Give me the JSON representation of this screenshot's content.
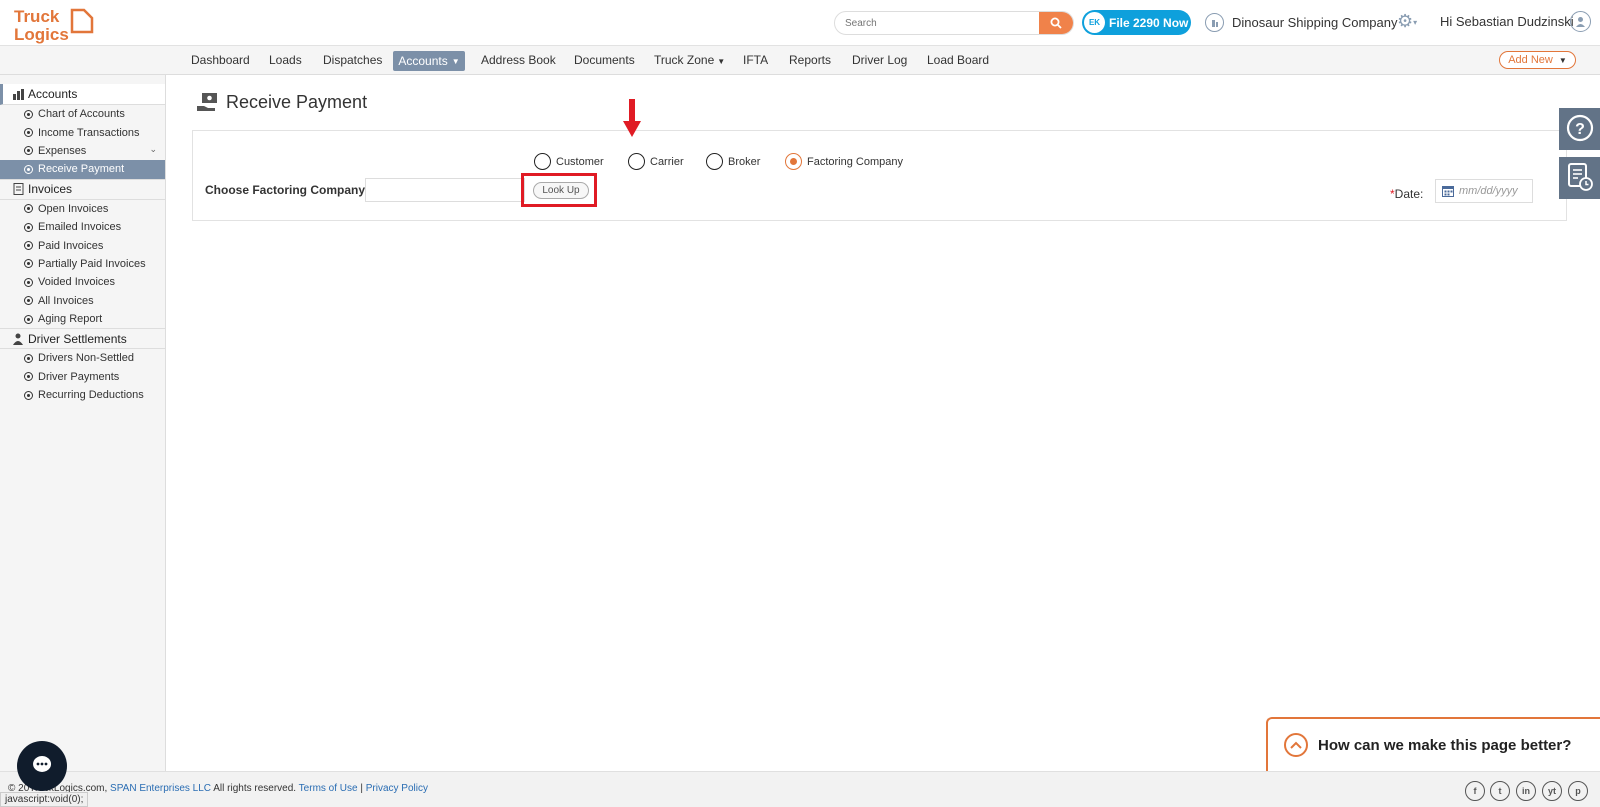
{
  "header": {
    "logo_text_top": "Truck",
    "logo_text_bottom": "Logics",
    "search_placeholder": "Search",
    "file_button_label": "File 2290 Now",
    "file_button_badge": "EK",
    "company_name": "Dinosaur Shipping Company",
    "greeting": "Hi Sebastian Dudzinski"
  },
  "nav": {
    "items": [
      "Dashboard",
      "Loads",
      "Dispatches",
      "Accounts",
      "Address Book",
      "Documents",
      "Truck Zone",
      "IFTA",
      "Reports",
      "Driver Log",
      "Load Board"
    ],
    "active": "Accounts",
    "add_new_label": "Add New"
  },
  "sidebar": {
    "sections": [
      {
        "title": "Accounts",
        "items": [
          "Chart of Accounts",
          "Income Transactions",
          "Expenses",
          "Receive Payment"
        ]
      },
      {
        "title": "Invoices",
        "items": [
          "Open Invoices",
          "Emailed Invoices",
          "Paid Invoices",
          "Partially Paid Invoices",
          "Voided Invoices",
          "All Invoices",
          "Aging Report"
        ]
      },
      {
        "title": "Driver Settlements",
        "items": [
          "Drivers Non-Settled",
          "Driver Payments",
          "Recurring Deductions"
        ]
      }
    ],
    "selected_item": "Receive Payment"
  },
  "page": {
    "title": "Receive Payment",
    "radio_options": [
      "Customer",
      "Carrier",
      "Broker",
      "Factoring Company"
    ],
    "selected_radio": "Factoring Company",
    "choose_label": "Choose Factoring Company:",
    "choose_value": "",
    "lookup_label": "Look Up",
    "date_label": "Date:",
    "date_required_mark": "*",
    "date_placeholder": "mm/dd/yyyy"
  },
  "feedback": {
    "label": "How can we make this page better?"
  },
  "footer": {
    "copyright_prefix": "© 20",
    "copyright_site": "TruckLogics.com,",
    "copyright_company": "SPAN Enterprises LLC",
    "copyright_suffix": "All rights reserved.",
    "terms_label": "Terms of Use",
    "separator": "|",
    "privacy_label": "Privacy Policy",
    "social": [
      "f",
      "t",
      "in",
      "yt",
      "p"
    ]
  },
  "status_bar_url": "javascript:void(0);",
  "colors": {
    "accent": "#e2763a",
    "nav_active": "#7c90a8",
    "highlight": "#e01b24",
    "file_button": "#0ea0dc"
  }
}
